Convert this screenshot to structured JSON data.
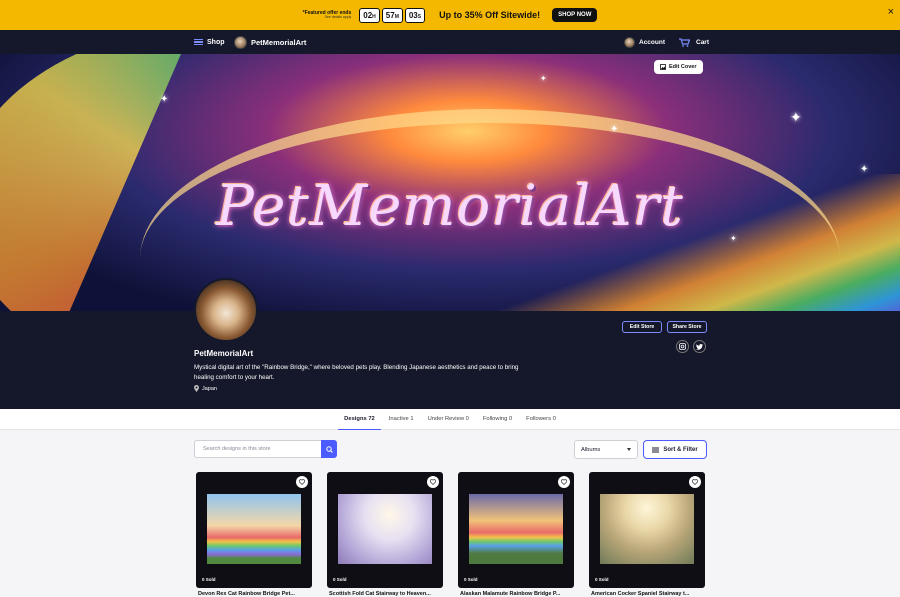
{
  "promo": {
    "offer_line1": "*Featured offer ends",
    "offer_line2": "See details apply",
    "timer": [
      {
        "value": "02",
        "unit": "H"
      },
      {
        "value": "57",
        "unit": "M"
      },
      {
        "value": "03",
        "unit": "S"
      }
    ],
    "headline": "Up to 35% Off Sitewide!",
    "cta": "SHOP NOW",
    "close": "×"
  },
  "nav": {
    "shop": "Shop",
    "store_name": "PetMemorialArt",
    "account": "Account",
    "cart": "Cart"
  },
  "cover": {
    "title": "PetMemorialArt",
    "edit_cover": "Edit Cover"
  },
  "profile": {
    "name": "PetMemorialArt",
    "bio": "Mystical digital art of the \"Rainbow Bridge,\" where beloved pets play. Blending Japanese aesthetics and peace to bring healing comfort to your heart.",
    "location": "Japan",
    "edit_store": "Edit Store",
    "share_store": "Share Store",
    "social": [
      "instagram-icon",
      "twitter-icon"
    ]
  },
  "tabs": [
    {
      "label": "Designs 72",
      "active": true
    },
    {
      "label": "Inactive 1",
      "active": false
    },
    {
      "label": "Under Review 0",
      "active": false
    },
    {
      "label": "Following 0",
      "active": false
    },
    {
      "label": "Followers 0",
      "active": false
    }
  ],
  "toolbar": {
    "search_placeholder": "Search designs in this store",
    "albums": "Albums",
    "sort_filter": "Sort & Filter"
  },
  "designs": [
    {
      "sold": "0 Sold",
      "title": "Devon Rex Cat Rainbow Bridge Pet..."
    },
    {
      "sold": "0 Sold",
      "title": "Scottish Fold Cat Stairway to Heaven..."
    },
    {
      "sold": "0 Sold",
      "title": "Alaskan Malamute Rainbow Bridge P..."
    },
    {
      "sold": "0 Sold",
      "title": "American Cocker Spaniel Stairway t..."
    }
  ],
  "colors": {
    "promo_bg": "#f5b800",
    "nav_bg": "#15182a",
    "accent": "#4a5cff"
  }
}
